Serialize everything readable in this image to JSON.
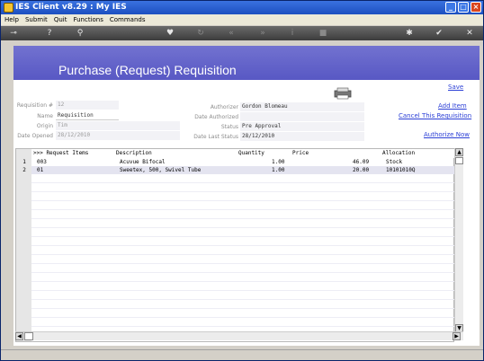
{
  "window": {
    "title": "IES Client v8.29 : My IES"
  },
  "menu": [
    "Help",
    "Submit",
    "Quit",
    "Functions",
    "Commands"
  ],
  "toolbar": [
    {
      "icon": "key-icon"
    },
    {
      "icon": "help-icon"
    },
    {
      "icon": "search-icon"
    },
    {
      "icon": "heart-icon"
    },
    {
      "icon": "refresh-icon"
    },
    {
      "icon": "rewind-icon"
    },
    {
      "icon": "forward-icon"
    },
    {
      "icon": "info-icon"
    },
    {
      "icon": "stop-icon"
    },
    {
      "icon": "gear-icon"
    },
    {
      "icon": "check-icon"
    },
    {
      "icon": "close-icon"
    }
  ],
  "page": {
    "title": "Purchase (Request) Requisition"
  },
  "actions": {
    "save": "Save",
    "add_item": "Add Item",
    "cancel": "Cancel This Requisition",
    "authorize": "Authorize Now"
  },
  "form": {
    "requisition_label": "Requisition #",
    "requisition_value": "12",
    "name_label": "Name",
    "name_value": "Requisition",
    "origin_label": "Origin",
    "origin_value": "Tim",
    "date_opened_label": "Date Opened",
    "date_opened_value": "28/12/2010",
    "authorizer_label": "Authorizer",
    "authorizer_value": "Gordon Blomeau",
    "date_authorized_label": "Date Authorized",
    "date_authorized_value": "",
    "status_label": "Status",
    "status_value": "Pre Approval",
    "date_last_status_label": "Date Last Status",
    "date_last_status_value": "28/12/2010"
  },
  "grid": {
    "columns": [
      ">>> Request Items",
      "Description",
      "Quantity",
      "Price",
      "Allocation"
    ],
    "rows": [
      {
        "num": "1",
        "item": "003",
        "description": "Acuvue Bifocal",
        "quantity": "1.00",
        "price": "46.09",
        "allocation": "Stock"
      },
      {
        "num": "2",
        "item": "01",
        "description": "Sweetex, 500, Swivel Tube",
        "quantity": "1.00",
        "price": "20.00",
        "allocation": "10101010Q"
      }
    ]
  },
  "colors": {
    "banner": "#5f5fc8",
    "link": "#2b3fd6",
    "titlebar": "#1c4fc0"
  }
}
